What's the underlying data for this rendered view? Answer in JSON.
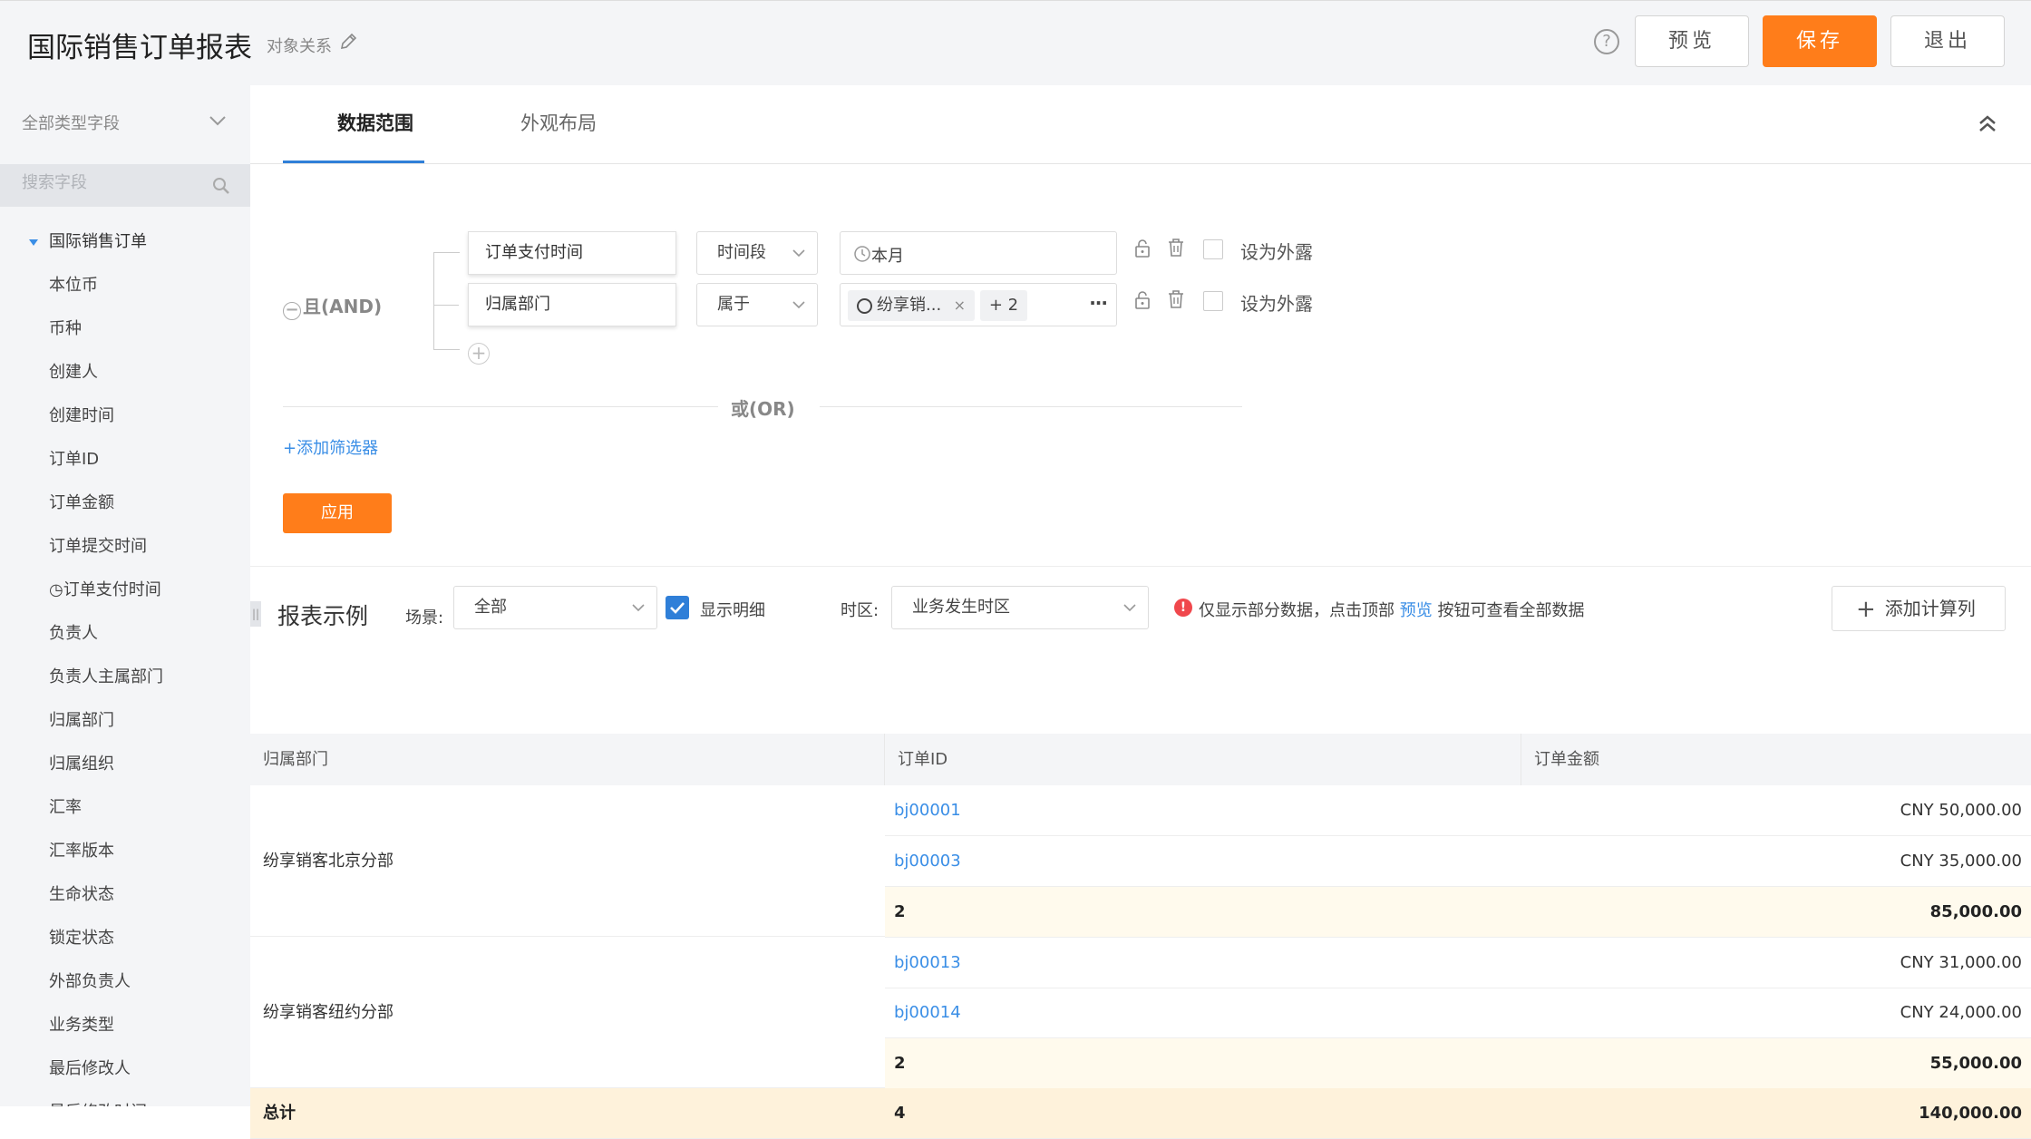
{
  "header": {
    "title": "国际销售订单报表",
    "subtitle": "对象关系",
    "preview_label": "预览",
    "save_label": "保存",
    "exit_label": "退出",
    "help_symbol": "?"
  },
  "sidebar": {
    "type_select": "全部类型字段",
    "search_placeholder": "搜索字段",
    "root": "国际销售订单",
    "fields": [
      "本位币",
      "币种",
      "创建人",
      "创建时间",
      "订单ID",
      "订单金额",
      "订单提交时间",
      "◷订单支付时间",
      "负责人",
      "负责人主属部门",
      "归属部门",
      "归属组织",
      "汇率",
      "汇率版本",
      "生命状态",
      "锁定状态",
      "外部负责人",
      "业务类型",
      "最后修改人",
      "最后修改时间"
    ]
  },
  "tabs": [
    {
      "label": "数据范围",
      "active": true
    },
    {
      "label": "外观布局",
      "active": false
    }
  ],
  "filter": {
    "and_label": "且(AND)",
    "or_label": "或(OR)",
    "rows": [
      {
        "field": "订单支付时间",
        "operator": "时间段",
        "value": "本月",
        "expose_label": "设为外露"
      },
      {
        "field": "归属部门",
        "operator": "属于",
        "tag": "纷享销...",
        "more_count": "+ 2",
        "expose_label": "设为外露"
      }
    ],
    "add_filter_label": "+添加筛选器",
    "apply_label": "应用"
  },
  "report": {
    "title": "报表示例",
    "scene_label": "场景:",
    "scene_value": "全部",
    "show_detail_label": "显示明细",
    "show_detail_checked": true,
    "timezone_label": "时区:",
    "timezone_value": "业务发生时区",
    "warning_prefix": "仅显示部分数据，点击顶部",
    "warning_link": "预览",
    "warning_suffix": "按钮可查看全部数据",
    "add_calc_label": "添加计算列",
    "columns": [
      "归属部门",
      "订单ID",
      "订单金额"
    ],
    "groups": [
      {
        "dept": "纷享销客北京分部",
        "rows": [
          {
            "id": "bj00001",
            "amount": "CNY 50,000.00"
          },
          {
            "id": "bj00003",
            "amount": "CNY 35,000.00"
          }
        ],
        "subtotal_count": "2",
        "subtotal_amount": "85,000.00"
      },
      {
        "dept": "纷享销客纽约分部",
        "rows": [
          {
            "id": "bj00013",
            "amount": "CNY 31,000.00"
          },
          {
            "id": "bj00014",
            "amount": "CNY 24,000.00"
          }
        ],
        "subtotal_count": "2",
        "subtotal_amount": "55,000.00"
      }
    ],
    "total_label": "总计",
    "total_count": "4",
    "total_amount": "140,000.00"
  },
  "colors": {
    "accent": "#ff7d1a",
    "link": "#3a8ee6",
    "warning": "#f0474c"
  }
}
